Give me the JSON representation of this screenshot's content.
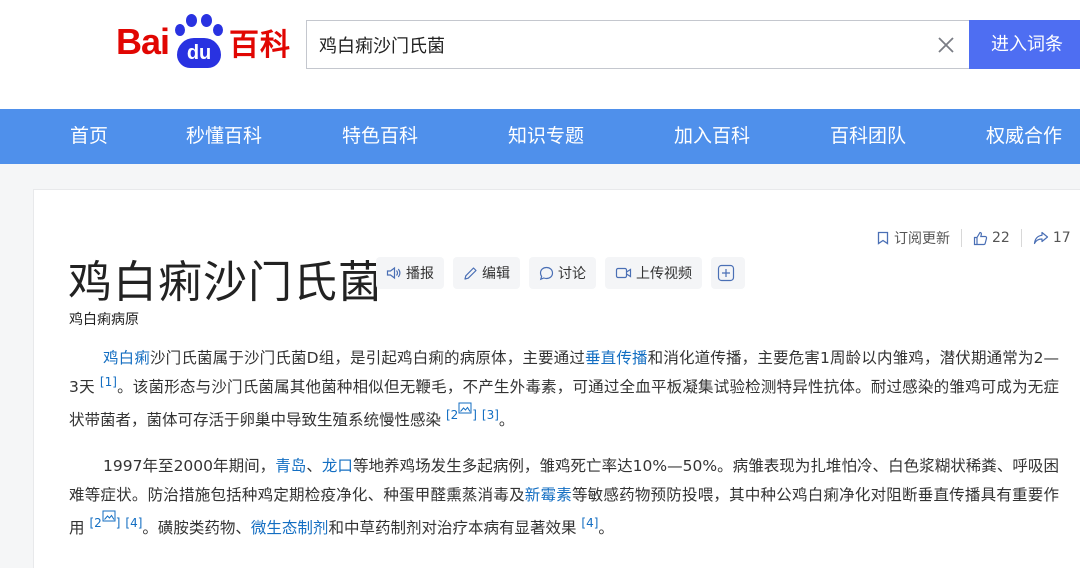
{
  "header": {
    "logo": {
      "part1": "Bai",
      "part2": "du",
      "part3": "百科"
    },
    "search": {
      "value": "鸡白痢沙门氏菌"
    },
    "enter_label": "进入词条"
  },
  "nav": {
    "items": [
      "首页",
      "秒懂百科",
      "特色百科",
      "知识专题",
      "加入百科",
      "百科团队",
      "权威合作"
    ]
  },
  "actions": {
    "subscribe": "订阅更新",
    "likes": "22",
    "shares": "17"
  },
  "entry": {
    "title": "鸡白痢沙门氏菌",
    "tools": [
      "播报",
      "编辑",
      "讨论",
      "上传视频"
    ],
    "subtitle": "鸡白痢病原",
    "p1": {
      "link1": "鸡白痢",
      "t1": "沙门氏菌属于沙门氏菌D组，是引起鸡白痢的病原体，主要通过",
      "link2": "垂直传播",
      "t2": "和消化道传播，主要危害1周龄以内雏鸡，潜伏期通常为2—3天",
      "ref1": "[1]",
      "t3": "。该菌形态与沙门氏菌属其他菌种相似但无鞭毛，不产生外毒素，可通过全血平板凝集试验检测特异性抗体。耐过感染的雏鸡可成为无症状带菌者，菌体可存活于卵巢中导致生殖系统慢性感染",
      "ref2": "[2",
      "ref2_end": "]",
      "ref3": "[3]",
      "end": "。"
    },
    "p2": {
      "t1": "1997年至2000年期间，",
      "link1": "青岛",
      "sep": "、",
      "link2": "龙口",
      "t2": "等地养鸡场发生多起病例，雏鸡死亡率达10%—50%。病雏表现为扎堆怕冷、白色浆糊状稀粪、呼吸困难等症状。防治措施包括种鸡定期检疫净化、种蛋甲醛熏蒸消毒及",
      "link3": "新霉素",
      "t3": "等敏感药物预防投喂，其中种公鸡白痢净化对阻断垂直传播具有重要作用",
      "ref2": "[2",
      "ref2_end": "]",
      "ref4": "[4]",
      "t4": "。磺胺类药物、",
      "link4": "微生态制剂",
      "t5": "和中草药制剂对治疗本病有显著效果",
      "ref4b": "[4]",
      "end": "。"
    }
  },
  "colors": {
    "brand_red": "#e10602",
    "brand_blue": "#2932e1",
    "nav_blue": "#4f90eb",
    "button_blue": "#4e6ef2",
    "link_blue": "#136ec2"
  }
}
